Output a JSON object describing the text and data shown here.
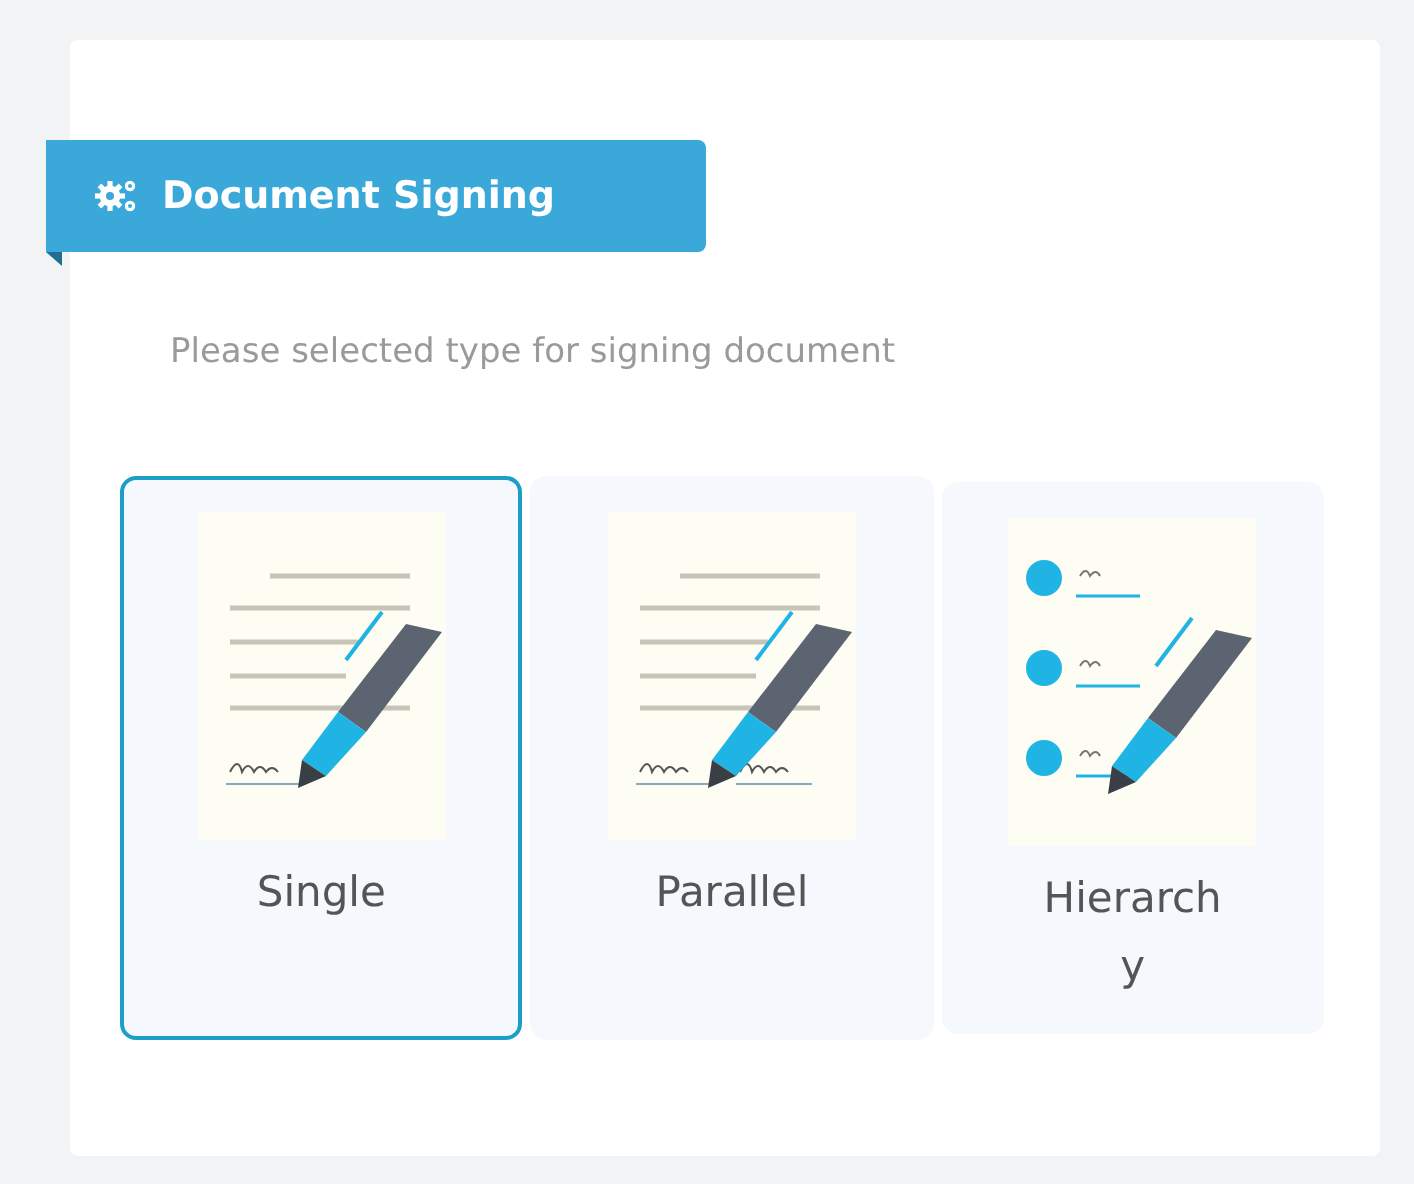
{
  "header": {
    "title": "Document Signing"
  },
  "instruction": "Please selected type for signing document",
  "options": [
    {
      "label": "Single",
      "kind": "single",
      "selected": true
    },
    {
      "label": "Parallel",
      "kind": "parallel",
      "selected": false
    },
    {
      "label": "Hierarchy",
      "kind": "hierarchy",
      "selected": false
    }
  ]
}
